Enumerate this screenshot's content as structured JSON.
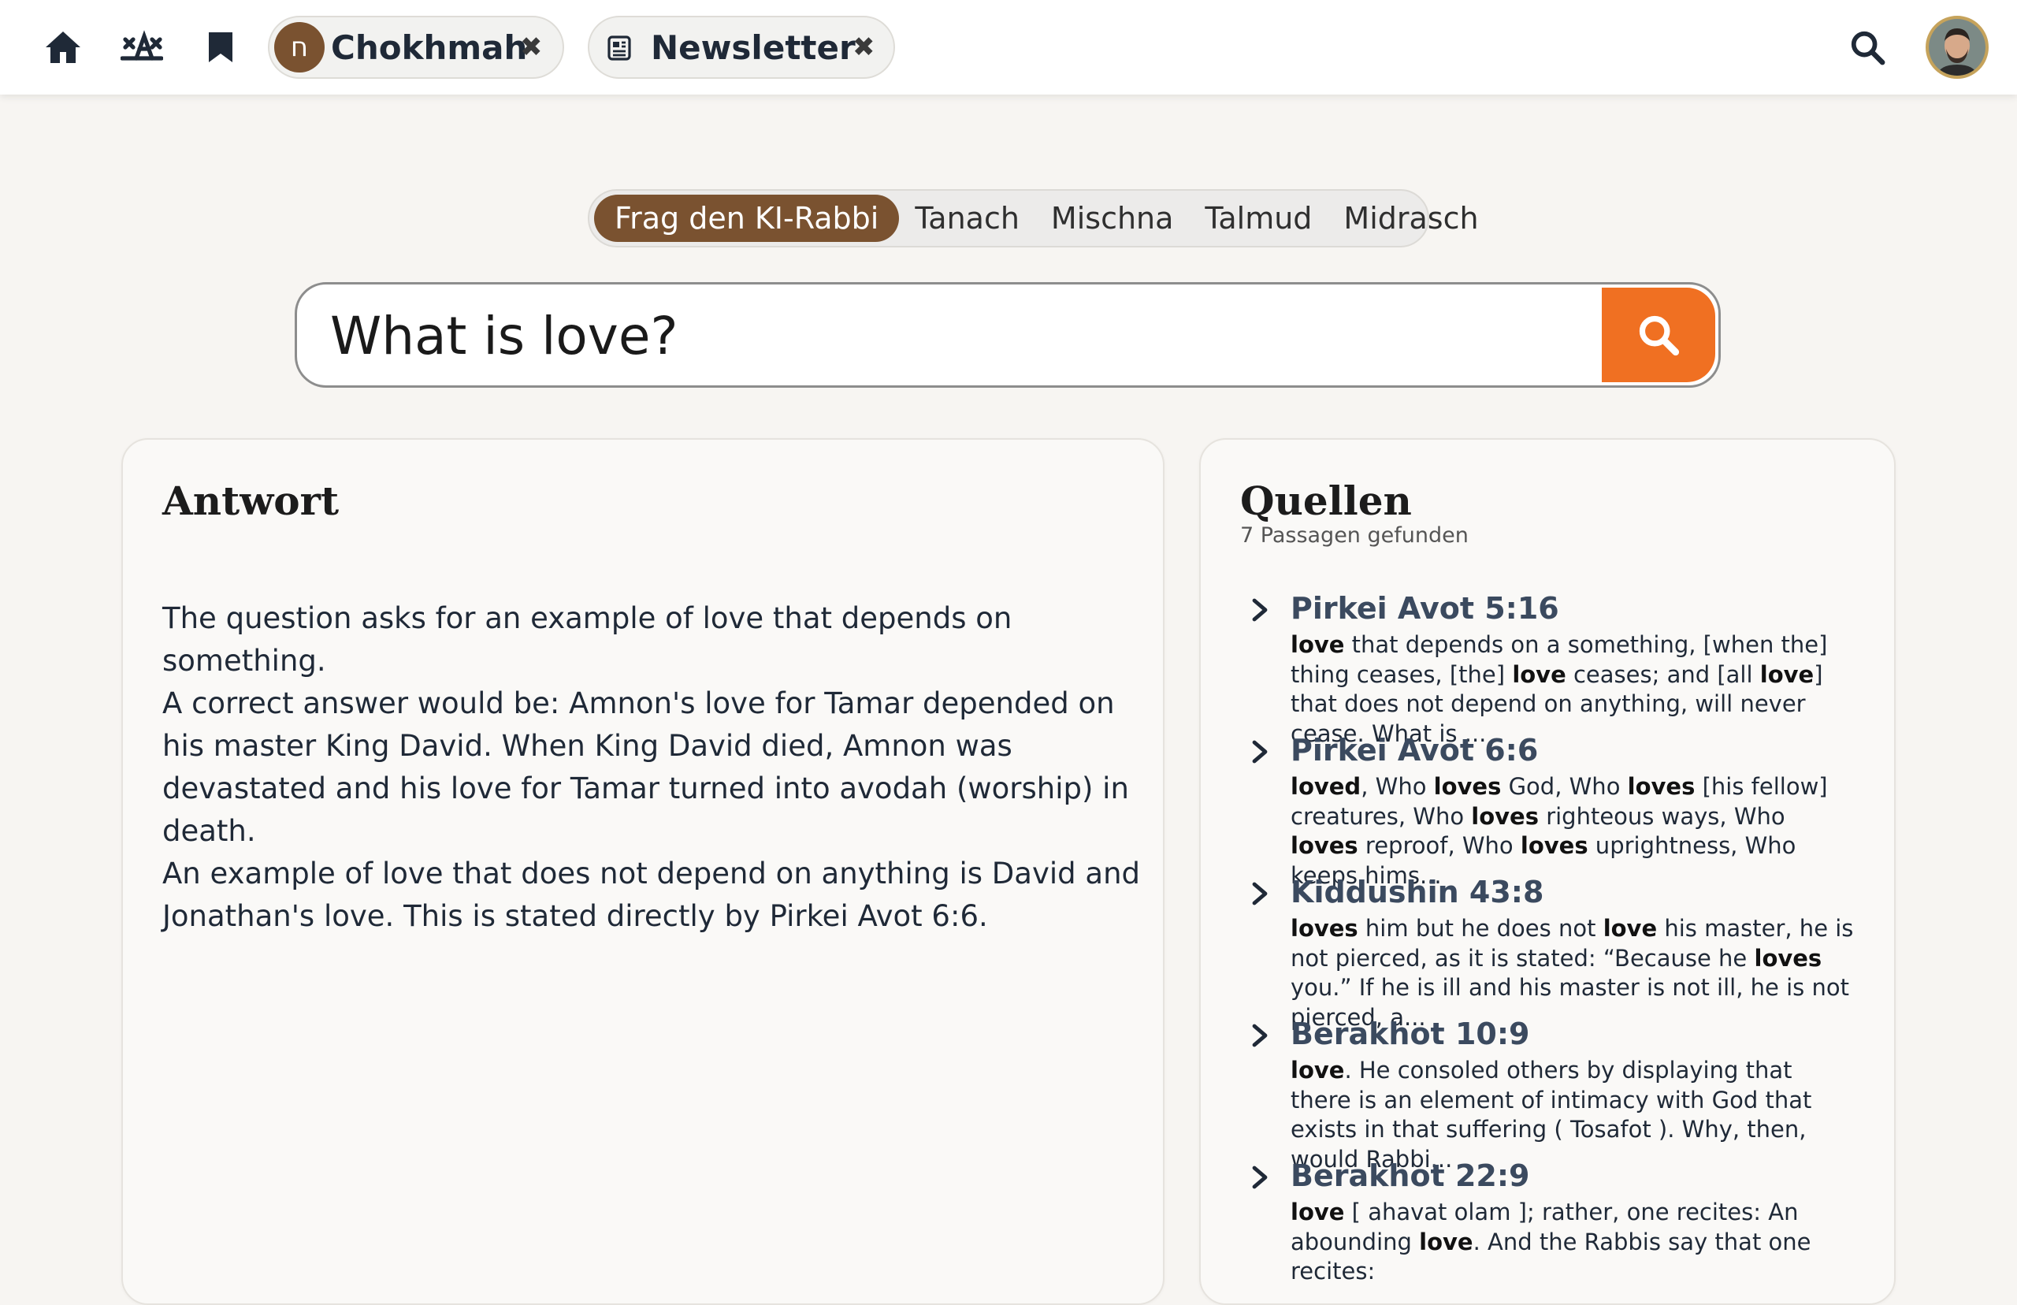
{
  "topbar": {
    "icons": {
      "home": "home-icon",
      "hebrew_letters": "alef-bet-icon",
      "bookmark": "bookmark-icon",
      "search": "search-icon"
    },
    "chip_chokhmah": {
      "label": "Chokhmah",
      "icon": "ח",
      "close": "✖"
    },
    "chip_newsletter": {
      "label": "Newsletter",
      "icon": "newspaper-icon",
      "close": "✖"
    }
  },
  "tabs": [
    {
      "label": "Frag den KI-Rabbi",
      "active": true
    },
    {
      "label": "Tanach",
      "active": false
    },
    {
      "label": "Mischna",
      "active": false
    },
    {
      "label": "Talmud",
      "active": false
    },
    {
      "label": "Midrasch",
      "active": false
    }
  ],
  "search": {
    "value": "What is love?"
  },
  "answer": {
    "title": "Antwort",
    "paragraphs": [
      "The question asks for an example of love that depends on something.",
      "A correct answer would be: Amnon's love for Tamar depended on his master King David. When King David died, Amnon was devastated and his love for Tamar turned into avodah (worship) in death.",
      "An example of love that does not depend on anything is David and Jonathan's love. This is stated directly by Pirkei Avot 6:6."
    ]
  },
  "sources": {
    "title": "Quellen",
    "count": "7 Passagen gefunden",
    "items": [
      {
        "ref": "Pirkei Avot 5:16",
        "segments": [
          {
            "t": "love",
            "b": true
          },
          {
            "t": " that depends on a something, [when the] thing ceases, [the] "
          },
          {
            "t": "love",
            "b": true
          },
          {
            "t": " ceases; and [all "
          },
          {
            "t": "love",
            "b": true
          },
          {
            "t": "] that does not depend on anything, will never cease. What is ..."
          }
        ]
      },
      {
        "ref": "Pirkei Avot 6:6",
        "segments": [
          {
            "t": "loved",
            "b": true
          },
          {
            "t": ", Who "
          },
          {
            "t": "loves",
            "b": true
          },
          {
            "t": " God, Who "
          },
          {
            "t": "loves",
            "b": true
          },
          {
            "t": " [his fellow] creatures, Who "
          },
          {
            "t": "loves",
            "b": true
          },
          {
            "t": " righteous ways, Who "
          },
          {
            "t": "loves",
            "b": true
          },
          {
            "t": " reproof, Who "
          },
          {
            "t": "loves",
            "b": true
          },
          {
            "t": " uprightness, Who keeps hims..."
          }
        ]
      },
      {
        "ref": "Kiddushin 43:8",
        "segments": [
          {
            "t": "loves",
            "b": true
          },
          {
            "t": " him but he does not "
          },
          {
            "t": "love",
            "b": true
          },
          {
            "t": " his master, he is not pierced, as it is stated: “Because he "
          },
          {
            "t": "loves",
            "b": true
          },
          {
            "t": " you.” If he is ill and his master is not ill, he is not pierced, a..."
          }
        ]
      },
      {
        "ref": "Berakhot 10:9",
        "segments": [
          {
            "t": "love",
            "b": true
          },
          {
            "t": ". He consoled others by displaying that there is an element of intimacy with God that exists in that suffering ( Tosafot ). Why, then, would Rabbi..."
          }
        ]
      },
      {
        "ref": "Berakhot 22:9",
        "segments": [
          {
            "t": "love",
            "b": true
          },
          {
            "t": " [ ahavat olam ]; rather, one recites: An abounding "
          },
          {
            "t": "love",
            "b": true
          },
          {
            "t": ". And the Rabbis say that one recites: "
          }
        ]
      }
    ]
  },
  "colors": {
    "accent_brown": "#7a5230",
    "search_orange": "#f07022",
    "source_title": "#3b4a5f",
    "background": "#f7f5f2"
  }
}
